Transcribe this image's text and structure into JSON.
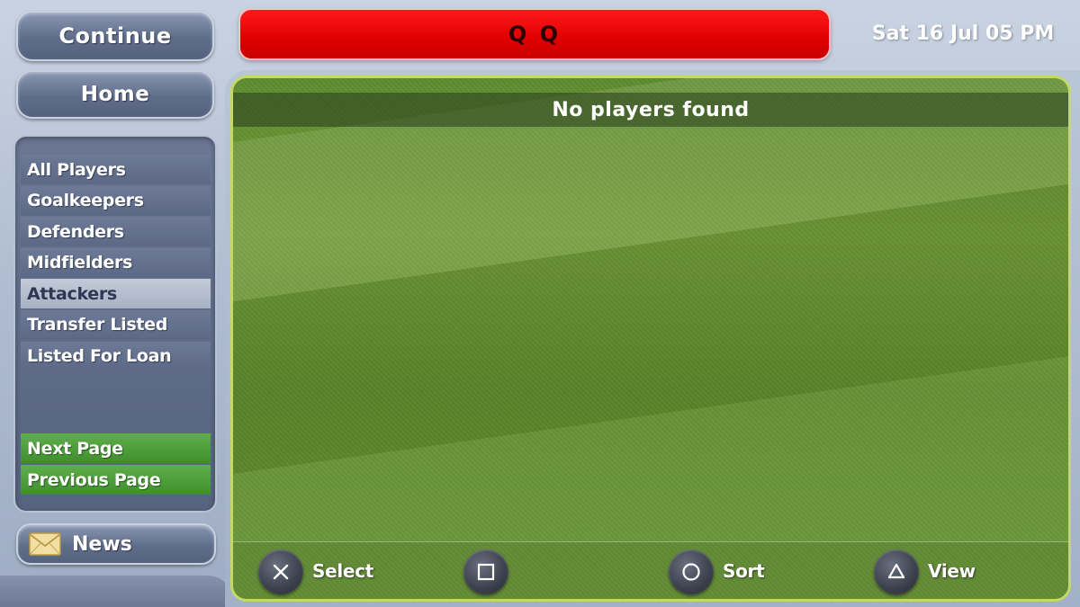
{
  "nav": {
    "continue_label": "Continue",
    "home_label": "Home",
    "news_label": "News"
  },
  "header": {
    "title": "Q Q",
    "date": "Sat 16 Jul 05 PM"
  },
  "menu": {
    "items": [
      {
        "label": "All Players",
        "selected": false
      },
      {
        "label": "Goalkeepers",
        "selected": false
      },
      {
        "label": "Defenders",
        "selected": false
      },
      {
        "label": "Midfielders",
        "selected": false
      },
      {
        "label": "Attackers",
        "selected": true
      },
      {
        "label": "Transfer Listed",
        "selected": false
      },
      {
        "label": "Listed For Loan",
        "selected": false
      }
    ],
    "next_page_label": "Next Page",
    "previous_page_label": "Previous Page"
  },
  "main": {
    "status_message": "No players found"
  },
  "controls": {
    "cross_label": "Select",
    "square_label": "",
    "circle_label": "Sort",
    "triangle_label": "View"
  },
  "colors": {
    "title_bar": "#e00000",
    "menu_selected": "#b4bdcf",
    "page_button": "#4a9b38",
    "pitch_green": "#669530"
  }
}
